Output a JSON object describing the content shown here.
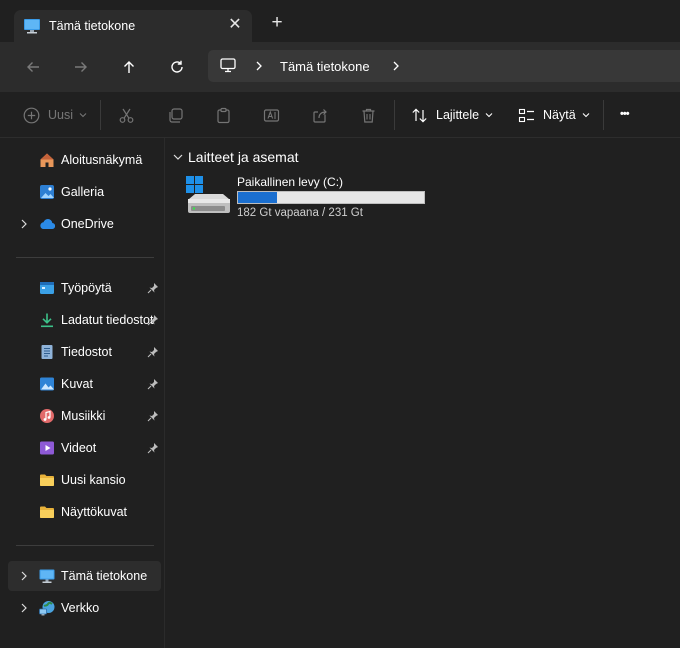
{
  "tab": {
    "title": "Tämä tietokone",
    "close_glyph": "✕",
    "new_glyph": "+",
    "icon": "monitor-icon"
  },
  "address": {
    "crumbs": [
      "Tämä tietokone"
    ],
    "icon": "monitor-icon"
  },
  "toolbar": {
    "new_label": "Uusi",
    "sort_label": "Lajittele",
    "view_label": "Näytä",
    "more_glyph": "•••"
  },
  "sidebar": {
    "quick": [
      {
        "label": "Aloitusnäkymä",
        "icon": "home-icon"
      },
      {
        "label": "Galleria",
        "icon": "gallery-icon"
      },
      {
        "label": "OneDrive",
        "icon": "cloud-icon",
        "expandable": true
      }
    ],
    "pinned": [
      {
        "label": "Työpöytä",
        "icon": "desktop-icon",
        "pinned": true
      },
      {
        "label": "Ladatut tiedostot",
        "icon": "download-icon",
        "pinned": true
      },
      {
        "label": "Tiedostot",
        "icon": "document-icon",
        "pinned": true
      },
      {
        "label": "Kuvat",
        "icon": "pictures-icon",
        "pinned": true
      },
      {
        "label": "Musiikki",
        "icon": "music-icon",
        "pinned": true
      },
      {
        "label": "Videot",
        "icon": "video-icon",
        "pinned": true
      },
      {
        "label": "Uusi kansio",
        "icon": "folder-icon"
      },
      {
        "label": "Näyttökuvat",
        "icon": "folder-icon"
      }
    ],
    "devices": [
      {
        "label": "Tämä tietokone",
        "icon": "monitor-icon",
        "expandable": true,
        "selected": true
      },
      {
        "label": "Verkko",
        "icon": "network-icon",
        "expandable": true
      }
    ]
  },
  "main": {
    "group_title": "Laitteet ja asemat",
    "drives": [
      {
        "name": "Paikallinen levy (C:)",
        "size_text": "182 Gt vapaana / 231 Gt",
        "used_fraction": 0.21,
        "icon": "drive-icon"
      }
    ]
  },
  "colors": {
    "accent": "#1a6fd0",
    "folder": "#f4c542",
    "background": "#202020"
  }
}
